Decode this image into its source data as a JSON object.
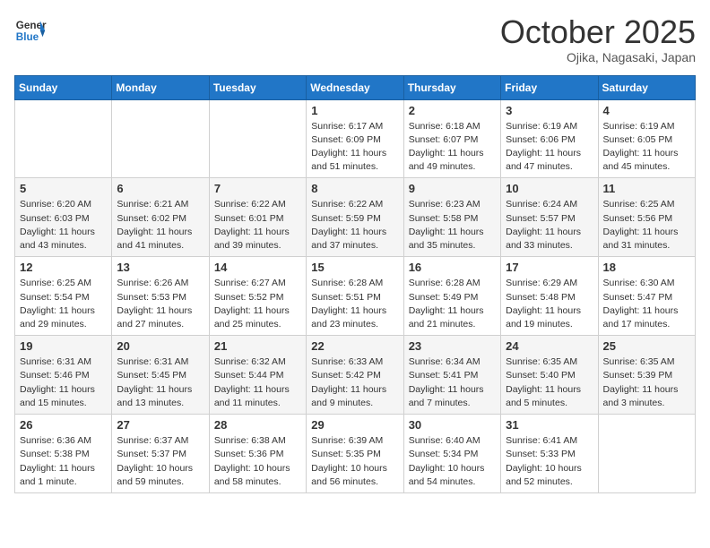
{
  "header": {
    "logo_general": "General",
    "logo_blue": "Blue",
    "month": "October 2025",
    "location": "Ojika, Nagasaki, Japan"
  },
  "days_of_week": [
    "Sunday",
    "Monday",
    "Tuesday",
    "Wednesday",
    "Thursday",
    "Friday",
    "Saturday"
  ],
  "weeks": [
    [
      {
        "day": "",
        "info": ""
      },
      {
        "day": "",
        "info": ""
      },
      {
        "day": "",
        "info": ""
      },
      {
        "day": "1",
        "info": "Sunrise: 6:17 AM\nSunset: 6:09 PM\nDaylight: 11 hours\nand 51 minutes."
      },
      {
        "day": "2",
        "info": "Sunrise: 6:18 AM\nSunset: 6:07 PM\nDaylight: 11 hours\nand 49 minutes."
      },
      {
        "day": "3",
        "info": "Sunrise: 6:19 AM\nSunset: 6:06 PM\nDaylight: 11 hours\nand 47 minutes."
      },
      {
        "day": "4",
        "info": "Sunrise: 6:19 AM\nSunset: 6:05 PM\nDaylight: 11 hours\nand 45 minutes."
      }
    ],
    [
      {
        "day": "5",
        "info": "Sunrise: 6:20 AM\nSunset: 6:03 PM\nDaylight: 11 hours\nand 43 minutes."
      },
      {
        "day": "6",
        "info": "Sunrise: 6:21 AM\nSunset: 6:02 PM\nDaylight: 11 hours\nand 41 minutes."
      },
      {
        "day": "7",
        "info": "Sunrise: 6:22 AM\nSunset: 6:01 PM\nDaylight: 11 hours\nand 39 minutes."
      },
      {
        "day": "8",
        "info": "Sunrise: 6:22 AM\nSunset: 5:59 PM\nDaylight: 11 hours\nand 37 minutes."
      },
      {
        "day": "9",
        "info": "Sunrise: 6:23 AM\nSunset: 5:58 PM\nDaylight: 11 hours\nand 35 minutes."
      },
      {
        "day": "10",
        "info": "Sunrise: 6:24 AM\nSunset: 5:57 PM\nDaylight: 11 hours\nand 33 minutes."
      },
      {
        "day": "11",
        "info": "Sunrise: 6:25 AM\nSunset: 5:56 PM\nDaylight: 11 hours\nand 31 minutes."
      }
    ],
    [
      {
        "day": "12",
        "info": "Sunrise: 6:25 AM\nSunset: 5:54 PM\nDaylight: 11 hours\nand 29 minutes."
      },
      {
        "day": "13",
        "info": "Sunrise: 6:26 AM\nSunset: 5:53 PM\nDaylight: 11 hours\nand 27 minutes."
      },
      {
        "day": "14",
        "info": "Sunrise: 6:27 AM\nSunset: 5:52 PM\nDaylight: 11 hours\nand 25 minutes."
      },
      {
        "day": "15",
        "info": "Sunrise: 6:28 AM\nSunset: 5:51 PM\nDaylight: 11 hours\nand 23 minutes."
      },
      {
        "day": "16",
        "info": "Sunrise: 6:28 AM\nSunset: 5:49 PM\nDaylight: 11 hours\nand 21 minutes."
      },
      {
        "day": "17",
        "info": "Sunrise: 6:29 AM\nSunset: 5:48 PM\nDaylight: 11 hours\nand 19 minutes."
      },
      {
        "day": "18",
        "info": "Sunrise: 6:30 AM\nSunset: 5:47 PM\nDaylight: 11 hours\nand 17 minutes."
      }
    ],
    [
      {
        "day": "19",
        "info": "Sunrise: 6:31 AM\nSunset: 5:46 PM\nDaylight: 11 hours\nand 15 minutes."
      },
      {
        "day": "20",
        "info": "Sunrise: 6:31 AM\nSunset: 5:45 PM\nDaylight: 11 hours\nand 13 minutes."
      },
      {
        "day": "21",
        "info": "Sunrise: 6:32 AM\nSunset: 5:44 PM\nDaylight: 11 hours\nand 11 minutes."
      },
      {
        "day": "22",
        "info": "Sunrise: 6:33 AM\nSunset: 5:42 PM\nDaylight: 11 hours\nand 9 minutes."
      },
      {
        "day": "23",
        "info": "Sunrise: 6:34 AM\nSunset: 5:41 PM\nDaylight: 11 hours\nand 7 minutes."
      },
      {
        "day": "24",
        "info": "Sunrise: 6:35 AM\nSunset: 5:40 PM\nDaylight: 11 hours\nand 5 minutes."
      },
      {
        "day": "25",
        "info": "Sunrise: 6:35 AM\nSunset: 5:39 PM\nDaylight: 11 hours\nand 3 minutes."
      }
    ],
    [
      {
        "day": "26",
        "info": "Sunrise: 6:36 AM\nSunset: 5:38 PM\nDaylight: 11 hours\nand 1 minute."
      },
      {
        "day": "27",
        "info": "Sunrise: 6:37 AM\nSunset: 5:37 PM\nDaylight: 10 hours\nand 59 minutes."
      },
      {
        "day": "28",
        "info": "Sunrise: 6:38 AM\nSunset: 5:36 PM\nDaylight: 10 hours\nand 58 minutes."
      },
      {
        "day": "29",
        "info": "Sunrise: 6:39 AM\nSunset: 5:35 PM\nDaylight: 10 hours\nand 56 minutes."
      },
      {
        "day": "30",
        "info": "Sunrise: 6:40 AM\nSunset: 5:34 PM\nDaylight: 10 hours\nand 54 minutes."
      },
      {
        "day": "31",
        "info": "Sunrise: 6:41 AM\nSunset: 5:33 PM\nDaylight: 10 hours\nand 52 minutes."
      },
      {
        "day": "",
        "info": ""
      }
    ]
  ]
}
